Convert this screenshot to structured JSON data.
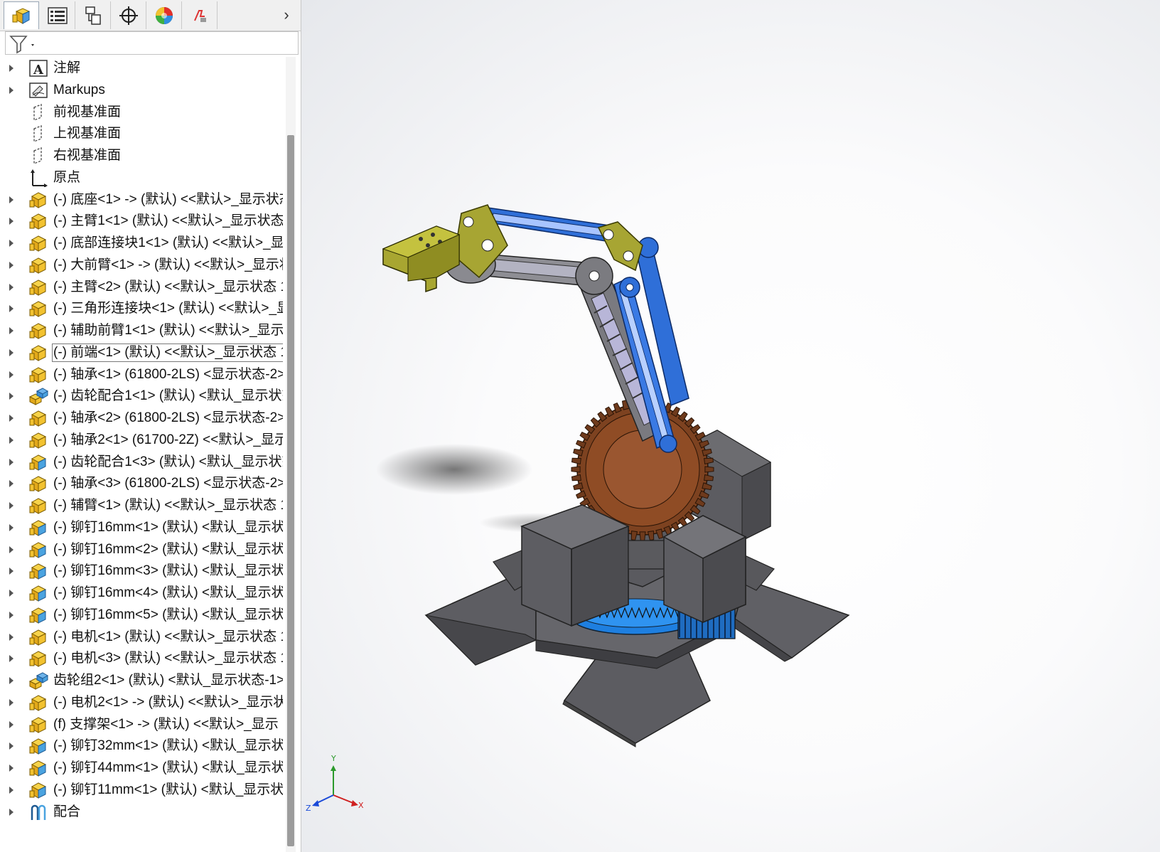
{
  "tabs": [
    {
      "name": "featuremanager-tab",
      "icon": "featuremanager-cube-icon"
    },
    {
      "name": "propertymanager-tab",
      "icon": "propertymanager-list-icon"
    },
    {
      "name": "configurationmanager-tab",
      "icon": "configuration-icon"
    },
    {
      "name": "dimxpert-tab",
      "icon": "crosshair-icon"
    },
    {
      "name": "display-manager-tab",
      "icon": "color-sphere-icon"
    },
    {
      "name": "cam-tab",
      "icon": "cam-icon"
    }
  ],
  "tree": {
    "items": [
      {
        "label": "注解",
        "icon": "annotation",
        "expand": true
      },
      {
        "label": "Markups",
        "icon": "markup",
        "expand": true
      },
      {
        "label": "前视基准面",
        "icon": "plane",
        "expand": false
      },
      {
        "label": "上视基准面",
        "icon": "plane",
        "expand": false
      },
      {
        "label": "右视基准面",
        "icon": "plane",
        "expand": false
      },
      {
        "label": "原点",
        "icon": "origin",
        "expand": false
      },
      {
        "label": "(-) 底座<1> -> (默认) <<默认>_显示状态",
        "icon": "part-yellow",
        "expand": true
      },
      {
        "label": "(-) 主臂1<1> (默认) <<默认>_显示状态",
        "icon": "part-yellow",
        "expand": true
      },
      {
        "label": "(-) 底部连接块1<1> (默认) <<默认>_显示",
        "icon": "part-yellow",
        "expand": true
      },
      {
        "label": "(-) 大前臂<1> -> (默认) <<默认>_显示状",
        "icon": "part-yellow",
        "expand": true
      },
      {
        "label": "(-) 主臂<2> (默认) <<默认>_显示状态 1",
        "icon": "part-yellow",
        "expand": true
      },
      {
        "label": "(-) 三角形连接块<1> (默认) <<默认>_显",
        "icon": "part-yellow",
        "expand": true
      },
      {
        "label": "(-) 辅助前臂1<1> (默认) <<默认>_显示",
        "icon": "part-yellow",
        "expand": true
      },
      {
        "label": "(-) 前端<1> (默认) <<默认>_显示状态 1",
        "icon": "part-yellow",
        "expand": true,
        "selected": true
      },
      {
        "label": "(-) 轴承<1> (61800-2LS) <显示状态-2>",
        "icon": "part-yellow",
        "expand": true
      },
      {
        "label": "(-) 齿轮配合1<1> (默认) <默认_显示状态",
        "icon": "assembly",
        "expand": true
      },
      {
        "label": "(-) 轴承<2> (61800-2LS) <显示状态-2>",
        "icon": "part-yellow",
        "expand": true
      },
      {
        "label": "(-) 轴承2<1> (61700-2Z) <<默认>_显示",
        "icon": "part-yellow",
        "expand": true
      },
      {
        "label": "(-) 齿轮配合1<3> (默认) <默认_显示状态",
        "icon": "part-blue",
        "expand": true
      },
      {
        "label": "(-) 轴承<3> (61800-2LS) <显示状态-2>",
        "icon": "part-yellow",
        "expand": true
      },
      {
        "label": "(-) 辅臂<1> (默认) <<默认>_显示状态 1",
        "icon": "part-yellow",
        "expand": true
      },
      {
        "label": "(-) 铆钉16mm<1> (默认) <默认_显示状",
        "icon": "part-blue",
        "expand": true
      },
      {
        "label": "(-) 铆钉16mm<2> (默认) <默认_显示状",
        "icon": "part-blue",
        "expand": true
      },
      {
        "label": "(-) 铆钉16mm<3> (默认) <默认_显示状",
        "icon": "part-blue",
        "expand": true
      },
      {
        "label": "(-) 铆钉16mm<4> (默认) <默认_显示状",
        "icon": "part-blue",
        "expand": true
      },
      {
        "label": "(-) 铆钉16mm<5> (默认) <默认_显示状",
        "icon": "part-blue",
        "expand": true
      },
      {
        "label": "(-) 电机<1> (默认) <<默认>_显示状态 1",
        "icon": "part-yellow",
        "expand": true
      },
      {
        "label": "(-) 电机<3> (默认) <<默认>_显示状态 1",
        "icon": "part-yellow",
        "expand": true
      },
      {
        "label": "齿轮组2<1> (默认) <默认_显示状态-1>",
        "icon": "assembly",
        "expand": true
      },
      {
        "label": "(-) 电机2<1> -> (默认) <<默认>_显示状",
        "icon": "part-yellow",
        "expand": true
      },
      {
        "label": "(f) 支撑架<1> -> (默认) <<默认>_显示",
        "icon": "part-yellow",
        "expand": true
      },
      {
        "label": "(-) 铆钉32mm<1> (默认) <默认_显示状",
        "icon": "part-blue",
        "expand": true
      },
      {
        "label": "(-) 铆钉44mm<1> (默认) <默认_显示状",
        "icon": "part-blue",
        "expand": true
      },
      {
        "label": "(-) 铆钉11mm<1> (默认) <默认_显示状",
        "icon": "part-blue",
        "expand": true
      },
      {
        "label": "配合",
        "icon": "mates",
        "expand": true
      }
    ]
  },
  "triad": {
    "x": "X",
    "y": "Y",
    "z": "Z"
  },
  "colors": {
    "panel_bg": "#ffffff",
    "tab_bg": "#f0f0f0",
    "part_yellow": "#f2c230",
    "part_blue": "#4aa3e0",
    "arm_blue": "#2f6fd8",
    "gear_brown": "#8a4a22",
    "base_gray": "#5f5f63",
    "gripper_olive": "#a7a533",
    "base_gear_blue": "#1e7fe0"
  }
}
